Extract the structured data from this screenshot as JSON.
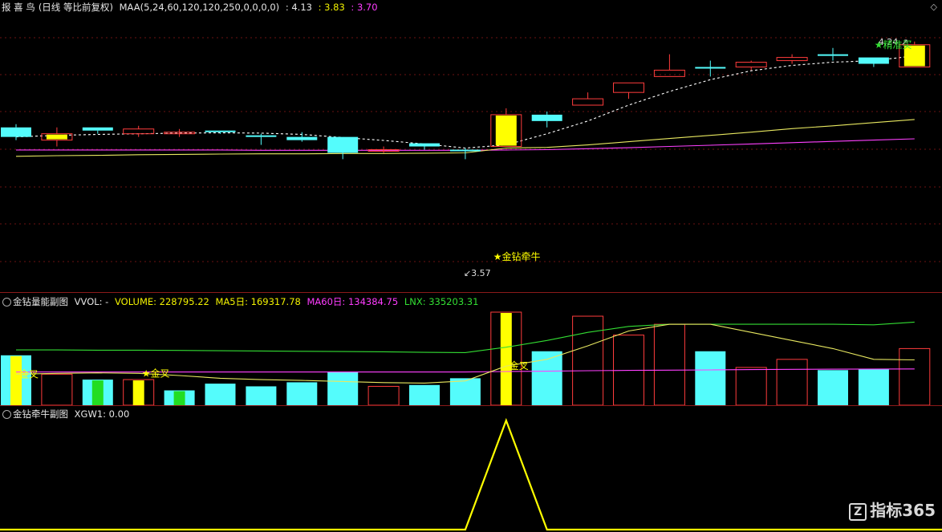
{
  "main_header": {
    "stock": "报 喜 鸟",
    "mode": "(日线 等比前复权)",
    "indicator": "MAA(5,24,60,120,120,250,0,0,0,0)",
    "v1": ": 4.13",
    "v2": ": 3.83",
    "v3": ": 3.70"
  },
  "sub1_header": {
    "title": "金钻量能副图",
    "vvol": "VVOL: -",
    "volume": "VOLUME: 228795.22",
    "ma5": "MA5日: 169317.78",
    "ma60": "MA60日: 134384.75",
    "lnx": "LNX: 335203.31"
  },
  "sub2_header": {
    "title": "金钻牵牛副图",
    "xgw": "XGW1: 0.00"
  },
  "watermark": "指标365",
  "colors": {
    "up": "#ff3c3c",
    "down": "#54fcfc",
    "signal": "#ffff00",
    "ma_white": "#ffffff",
    "ma_yellow": "#e8e860",
    "ma_magenta": "#ff40ff",
    "vol_green": "#22dd22",
    "grid": "#6b1212"
  },
  "chart_data": [
    {
      "type": "candlestick",
      "title": "报 喜 鸟",
      "price_range": [
        3.5,
        4.3
      ],
      "candles": [
        {
          "o": 3.97,
          "h": 3.98,
          "l": 3.93,
          "c": 3.94,
          "signal": false
        },
        {
          "o": 3.93,
          "h": 3.97,
          "l": 3.91,
          "c": 3.95,
          "signal": true
        },
        {
          "o": 3.97,
          "h": 3.97,
          "l": 3.95,
          "c": 3.96,
          "signal": false
        },
        {
          "o": 3.95,
          "h": 3.975,
          "l": 3.94,
          "c": 3.965,
          "signal": false
        },
        {
          "o": 3.955,
          "h": 3.965,
          "l": 3.94,
          "c": 3.955,
          "signal": false
        },
        {
          "o": 3.96,
          "h": 3.96,
          "l": 3.95,
          "c": 3.955,
          "signal": false
        },
        {
          "o": 3.945,
          "h": 3.95,
          "l": 3.915,
          "c": 3.94,
          "signal": false
        },
        {
          "o": 3.94,
          "h": 3.955,
          "l": 3.925,
          "c": 3.93,
          "signal": false
        },
        {
          "o": 3.94,
          "h": 3.94,
          "l": 3.87,
          "c": 3.89,
          "signal": false
        },
        {
          "o": 3.9,
          "h": 3.91,
          "l": 3.89,
          "c": 3.9,
          "signal": false
        },
        {
          "o": 3.92,
          "h": 3.92,
          "l": 3.9,
          "c": 3.91,
          "signal": false
        },
        {
          "o": 3.9,
          "h": 3.905,
          "l": 3.87,
          "c": 3.897,
          "signal": false
        },
        {
          "o": 3.91,
          "h": 4.03,
          "l": 3.91,
          "c": 4.01,
          "signal": true
        },
        {
          "o": 4.01,
          "h": 4.02,
          "l": 3.97,
          "c": 3.99,
          "signal": false
        },
        {
          "o": 4.04,
          "h": 4.08,
          "l": 4.04,
          "c": 4.06,
          "signal": false
        },
        {
          "o": 4.08,
          "h": 4.11,
          "l": 4.06,
          "c": 4.11,
          "signal": false
        },
        {
          "o": 4.13,
          "h": 4.2,
          "l": 4.13,
          "c": 4.15,
          "signal": false
        },
        {
          "o": 4.16,
          "h": 4.18,
          "l": 4.13,
          "c": 4.155,
          "signal": false
        },
        {
          "o": 4.16,
          "h": 4.18,
          "l": 4.15,
          "c": 4.175,
          "signal": false
        },
        {
          "o": 4.18,
          "h": 4.2,
          "l": 4.17,
          "c": 4.19,
          "signal": false
        },
        {
          "o": 4.2,
          "h": 4.22,
          "l": 4.18,
          "c": 4.195,
          "signal": false
        },
        {
          "o": 4.19,
          "h": 4.19,
          "l": 4.16,
          "c": 4.17,
          "signal": false
        },
        {
          "o": 4.16,
          "h": 4.24,
          "l": 4.16,
          "c": 4.23,
          "signal": true
        }
      ],
      "ma_white": [
        3.94,
        3.945,
        3.948,
        3.95,
        3.952,
        3.953,
        3.952,
        3.948,
        3.938,
        3.929,
        3.918,
        3.905,
        3.915,
        3.95,
        3.99,
        4.04,
        4.083,
        4.12,
        4.148,
        4.165,
        4.175,
        4.18,
        4.195
      ],
      "ma_yellow": [
        3.879,
        3.881,
        3.882,
        3.884,
        3.885,
        3.886,
        3.887,
        3.887,
        3.888,
        3.888,
        3.889,
        3.89,
        3.905,
        3.907,
        3.915,
        3.925,
        3.935,
        3.945,
        3.955,
        3.966,
        3.975,
        3.985,
        3.995
      ],
      "ma_magenta": [
        3.899,
        3.899,
        3.899,
        3.899,
        3.899,
        3.899,
        3.898,
        3.898,
        3.898,
        3.898,
        3.898,
        3.898,
        3.899,
        3.9,
        3.903,
        3.906,
        3.91,
        3.914,
        3.918,
        3.922,
        3.926,
        3.93,
        3.934
      ],
      "annotations": [
        {
          "text": "4.24",
          "candle": 22,
          "value": 4.24
        },
        {
          "text": "3.57",
          "candle": 11,
          "value": 3.57
        },
        {
          "text": "★金钻牵牛",
          "candle": 12
        },
        {
          "text": "★精准买",
          "candle": 22
        }
      ]
    },
    {
      "type": "bar",
      "title": "金钻量能副图",
      "volume_range": [
        0,
        345000
      ],
      "volumes": [
        185000,
        115000,
        95000,
        95000,
        55000,
        80000,
        70000,
        85000,
        125000,
        70000,
        75000,
        100000,
        345000,
        200000,
        330000,
        260000,
        300000,
        200000,
        140000,
        170000,
        130000,
        135000,
        210000
      ],
      "up": [
        false,
        true,
        false,
        true,
        false,
        false,
        false,
        false,
        false,
        true,
        false,
        false,
        true,
        false,
        true,
        true,
        true,
        false,
        true,
        true,
        false,
        false,
        true
      ],
      "inner": [
        {
          "candle": 0,
          "color": "yellow",
          "value": 185000
        },
        {
          "candle": 2,
          "color": "green",
          "value": 95000
        },
        {
          "candle": 3,
          "color": "yellow",
          "value": 95000
        },
        {
          "candle": 4,
          "color": "green",
          "value": 55000
        },
        {
          "candle": 12,
          "color": "yellow",
          "value": 345000
        }
      ],
      "ma5_line": [
        115000,
        118000,
        120000,
        118000,
        110000,
        100000,
        95000,
        92000,
        88000,
        84000,
        82000,
        90000,
        145000,
        170000,
        220000,
        275000,
        300000,
        300000,
        270000,
        240000,
        210000,
        170000,
        168000
      ],
      "ma60_line": [
        123000,
        123000,
        123000,
        123000,
        123000,
        123000,
        123000,
        123000,
        123000,
        123000,
        123000,
        123000,
        125000,
        126000,
        128000,
        129000,
        130000,
        131000,
        132000,
        133000,
        133500,
        134000,
        134400
      ],
      "lnx_line": [
        205000,
        205000,
        204000,
        204000,
        203000,
        202000,
        201000,
        200000,
        199000,
        198000,
        196000,
        195000,
        215000,
        240000,
        270000,
        292000,
        300000,
        300000,
        300000,
        300000,
        300000,
        298000,
        308000
      ],
      "annotations": [
        {
          "text": "金叉",
          "candle": 0
        },
        {
          "text": "★金叉",
          "candle": 3
        },
        {
          "text": "金叉",
          "candle": 12
        }
      ]
    },
    {
      "type": "line",
      "title": "金钻牵牛副图",
      "series": [
        {
          "name": "XGW1",
          "values": [
            0,
            0,
            0,
            0,
            0,
            0,
            0,
            0,
            0,
            0,
            0,
            0,
            1,
            0,
            0,
            0,
            0,
            0,
            0,
            0,
            0,
            0,
            0
          ]
        }
      ],
      "ylim": [
        0,
        1
      ]
    }
  ]
}
